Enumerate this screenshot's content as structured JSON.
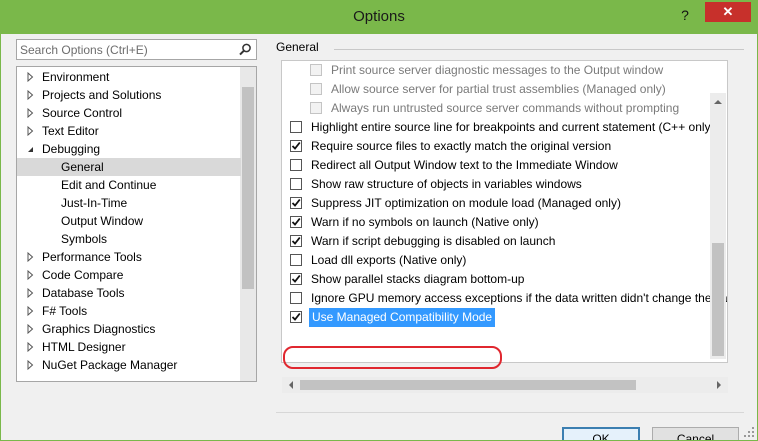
{
  "window": {
    "title": "Options",
    "help_glyph": "?",
    "close_glyph": "✕"
  },
  "search": {
    "placeholder": "Search Options (Ctrl+E)",
    "icon": "search-icon"
  },
  "tree": {
    "items": [
      {
        "label": "Environment",
        "expandable": true,
        "expanded": false,
        "level": 0
      },
      {
        "label": "Projects and Solutions",
        "expandable": true,
        "expanded": false,
        "level": 0
      },
      {
        "label": "Source Control",
        "expandable": true,
        "expanded": false,
        "level": 0
      },
      {
        "label": "Text Editor",
        "expandable": true,
        "expanded": false,
        "level": 0
      },
      {
        "label": "Debugging",
        "expandable": true,
        "expanded": true,
        "level": 0
      },
      {
        "label": "General",
        "expandable": false,
        "level": 1,
        "selected": true
      },
      {
        "label": "Edit and Continue",
        "expandable": false,
        "level": 1
      },
      {
        "label": "Just-In-Time",
        "expandable": false,
        "level": 1
      },
      {
        "label": "Output Window",
        "expandable": false,
        "level": 1
      },
      {
        "label": "Symbols",
        "expandable": false,
        "level": 1
      },
      {
        "label": "Performance Tools",
        "expandable": true,
        "expanded": false,
        "level": 0
      },
      {
        "label": "Code Compare",
        "expandable": true,
        "expanded": false,
        "level": 0
      },
      {
        "label": "Database Tools",
        "expandable": true,
        "expanded": false,
        "level": 0
      },
      {
        "label": "F# Tools",
        "expandable": true,
        "expanded": false,
        "level": 0
      },
      {
        "label": "Graphics Diagnostics",
        "expandable": true,
        "expanded": false,
        "level": 0
      },
      {
        "label": "HTML Designer",
        "expandable": true,
        "expanded": false,
        "level": 0
      },
      {
        "label": "NuGet Package Manager",
        "expandable": true,
        "expanded": false,
        "level": 0
      }
    ]
  },
  "panel": {
    "title": "General",
    "options": [
      {
        "label": "Print source server diagnostic messages to the Output window",
        "checked": false,
        "disabled": true,
        "indent": 1
      },
      {
        "label": "Allow source server for partial trust assemblies (Managed only)",
        "checked": false,
        "disabled": true,
        "indent": 1
      },
      {
        "label": "Always run untrusted source server commands without prompting",
        "checked": false,
        "disabled": true,
        "indent": 1
      },
      {
        "label": "Highlight entire source line for breakpoints and current statement (C++ only)",
        "checked": false,
        "disabled": false,
        "indent": 0
      },
      {
        "label": "Require source files to exactly match the original version",
        "checked": true,
        "disabled": false,
        "indent": 0
      },
      {
        "label": "Redirect all Output Window text to the Immediate Window",
        "checked": false,
        "disabled": false,
        "indent": 0
      },
      {
        "label": "Show raw structure of objects in variables windows",
        "checked": false,
        "disabled": false,
        "indent": 0
      },
      {
        "label": "Suppress JIT optimization on module load (Managed only)",
        "checked": true,
        "disabled": false,
        "indent": 0
      },
      {
        "label": "Warn if no symbols on launch (Native only)",
        "checked": true,
        "disabled": false,
        "indent": 0
      },
      {
        "label": "Warn if script debugging is disabled on launch",
        "checked": true,
        "disabled": false,
        "indent": 0
      },
      {
        "label": "Load dll exports (Native only)",
        "checked": false,
        "disabled": false,
        "indent": 0
      },
      {
        "label": "Show parallel stacks diagram bottom-up",
        "checked": true,
        "disabled": false,
        "indent": 0
      },
      {
        "label": "Ignore GPU memory access exceptions if the data written didn't change the value",
        "checked": false,
        "disabled": false,
        "indent": 0
      },
      {
        "label": "Use Managed Compatibility Mode",
        "checked": true,
        "disabled": false,
        "indent": 0,
        "highlighted": true
      }
    ]
  },
  "buttons": {
    "ok": "OK",
    "cancel": "Cancel"
  },
  "colors": {
    "titlebar": "#7ab84a",
    "close": "#c7302b",
    "selection": "#3399ff",
    "callout": "#e0272f"
  }
}
